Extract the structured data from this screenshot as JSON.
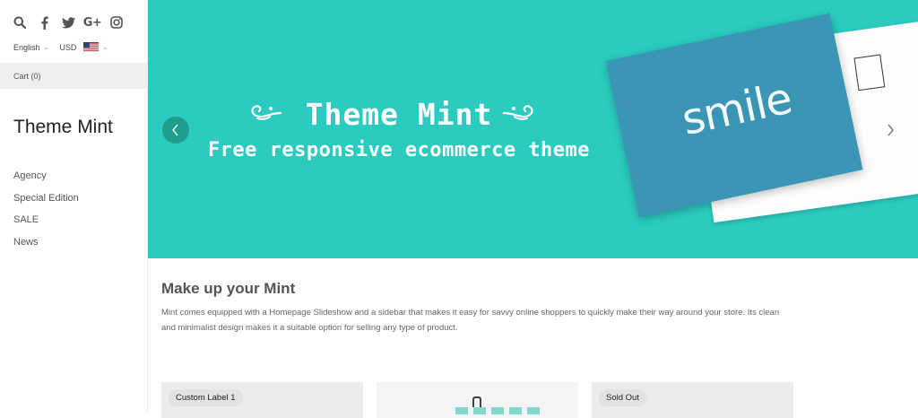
{
  "header": {
    "social": [
      "search-icon",
      "facebook-icon",
      "twitter-icon",
      "google-plus-icon",
      "instagram-icon"
    ],
    "google_plus_glyph": "G+",
    "language": "English",
    "currency": "USD"
  },
  "cart": {
    "label": "Cart (0)"
  },
  "shop": {
    "title": "Theme Mint"
  },
  "nav": {
    "items": [
      "Agency",
      "Special Edition",
      "SALE",
      "News"
    ]
  },
  "slideshow": {
    "headline": "Theme Mint",
    "subline": "Free responsive ecommerce theme",
    "postcard_word": "smile",
    "bg_color": "#2bcbc0"
  },
  "about": {
    "title": "Make up your Mint",
    "text": "Mint comes equipped with a Homepage Slideshow and a sidebar that makes it easy for savvy online shoppers to quickly make their way around your store. Its clean and minimalist design makes it a suitable option for selling any type of product."
  },
  "products": [
    {
      "badge": "Custom Label 1"
    },
    {
      "badge": ""
    },
    {
      "badge": "Sold Out"
    }
  ]
}
